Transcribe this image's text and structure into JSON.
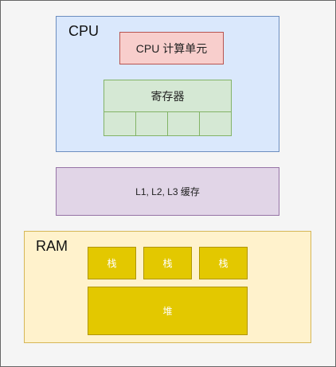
{
  "cpu": {
    "label": "CPU",
    "compute_unit": "CPU 计算单元",
    "registers": "寄存器",
    "register_cells": 4
  },
  "cache": {
    "label": "L1, L2, L3 缓存"
  },
  "ram": {
    "label": "RAM",
    "stacks": [
      "栈",
      "栈",
      "栈"
    ],
    "heap": "堆"
  },
  "colors": {
    "cpu_fill": "#dae8fc",
    "cpu_stroke": "#6c8ebf",
    "compute_fill": "#f8cecc",
    "compute_stroke": "#b85450",
    "reg_fill": "#d5e8d4",
    "reg_stroke": "#82b366",
    "cache_fill": "#e1d5e7",
    "cache_stroke": "#9673a6",
    "ram_fill": "#fff2cc",
    "ram_stroke": "#d6b656",
    "mem_fill": "#e3c800",
    "mem_stroke": "#b09500"
  }
}
